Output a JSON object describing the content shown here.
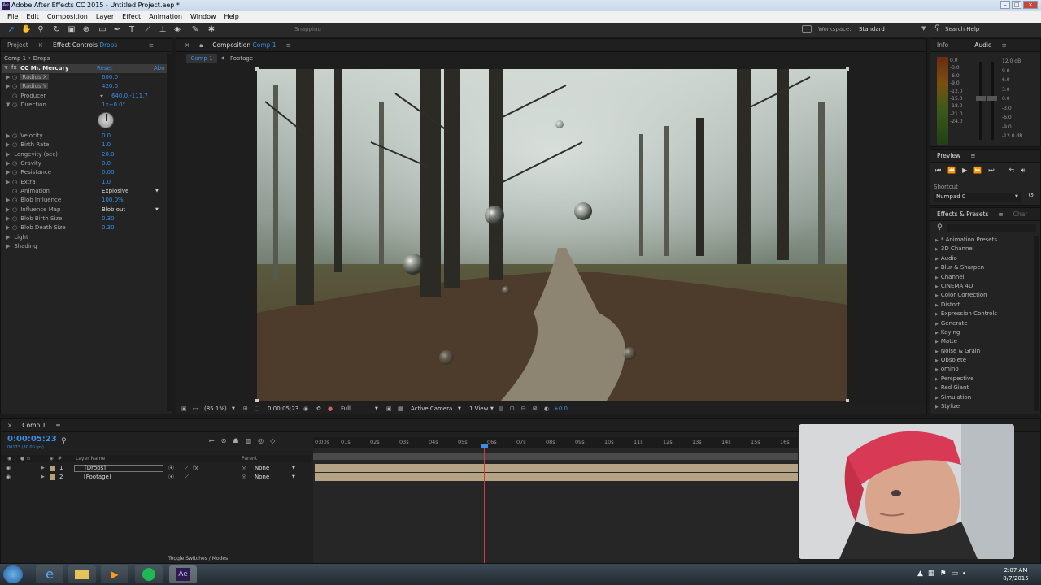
{
  "window": {
    "title": "Adobe After Effects CC 2015 - Untitled Project.aep *"
  },
  "menu": [
    "File",
    "Edit",
    "Composition",
    "Layer",
    "Effect",
    "Animation",
    "Window",
    "Help"
  ],
  "toolbar": {
    "snapping": "Snapping",
    "workspace_label": "Workspace:",
    "workspace_value": "Standard",
    "search_placeholder": "Search Help"
  },
  "effect_controls": {
    "tab_project": "Project",
    "tab_label": "Effect Controls",
    "tab_layer": "Drops",
    "breadcrumb": "Comp 1 • Drops",
    "effect_name": "CC Mr. Mercury",
    "reset": "Reset",
    "about": "Abo",
    "props": [
      {
        "label": "Radius X",
        "value": "600.0",
        "highlight": true
      },
      {
        "label": "Radius Y",
        "value": "420.0",
        "highlight": true
      },
      {
        "label": "Producer",
        "value": "640.0,-111.7"
      },
      {
        "label": "Direction",
        "value": "1x+0.0°"
      },
      {
        "label": "Velocity",
        "value": "0.0"
      },
      {
        "label": "Birth Rate",
        "value": "1.0"
      },
      {
        "label": "Longevity (sec)",
        "value": "20.0"
      },
      {
        "label": "Gravity",
        "value": "0.0"
      },
      {
        "label": "Resistance",
        "value": "0.00"
      },
      {
        "label": "Extra",
        "value": "1.0"
      },
      {
        "label": "Animation",
        "value": "Explosive"
      },
      {
        "label": "Blob Influence",
        "value": "100.0%"
      },
      {
        "label": "Influence Map",
        "value": "Blob out"
      },
      {
        "label": "Blob Birth Size",
        "value": "0.30"
      },
      {
        "label": "Blob Death Size",
        "value": "0.30"
      },
      {
        "label": "Light",
        "value": ""
      },
      {
        "label": "Shading",
        "value": ""
      }
    ]
  },
  "composition": {
    "tab_label": "Composition",
    "tab_comp": "Comp 1",
    "sub_tabs": [
      "Comp 1",
      "Footage"
    ],
    "zoom": "(85.1%)",
    "timecode": "0;00;05;23",
    "resolution": "Full",
    "camera": "Active Camera",
    "views": "1 View",
    "exposure": "+0.0"
  },
  "info_audio": {
    "tab_info": "Info",
    "tab_audio": "Audio",
    "left_scale": [
      "0.0",
      "-3.0",
      "-6.0",
      "-9.0",
      "-12.0",
      "-15.0",
      "-18.0",
      "-21.0",
      "-24.0"
    ],
    "right_scale": [
      "12.0 dB",
      "9.0",
      "6.0",
      "3.0",
      "0.0",
      "-3.0",
      "-6.0",
      "-9.0",
      "-12.0 dB"
    ]
  },
  "preview": {
    "tab_label": "Preview",
    "shortcut_label": "Shortcut",
    "shortcut_value": "Numpad 0"
  },
  "effects_presets": {
    "tab_label": "Effects & Presets",
    "tab_other": "Char",
    "items": [
      "* Animation Presets",
      "3D Channel",
      "Audio",
      "Blur & Sharpen",
      "Channel",
      "CINEMA 4D",
      "Color Correction",
      "Distort",
      "Expression Controls",
      "Generate",
      "Keying",
      "Matte",
      "Noise & Grain",
      "Obsolete",
      "omino",
      "Perspective",
      "Red Giant",
      "Simulation",
      "Stylize"
    ]
  },
  "timeline": {
    "tab_label": "Comp 1",
    "timecode": "0:00:05:23",
    "frame_info": "00173 (30.00 fps)",
    "col_layer_name": "Layer Name",
    "col_parent": "Parent",
    "ruler": [
      "0:00s",
      "01s",
      "02s",
      "03s",
      "04s",
      "05s",
      "06s",
      "07s",
      "08s",
      "09s",
      "10s",
      "11s",
      "12s",
      "13s",
      "14s",
      "15s",
      "16s"
    ],
    "layers": [
      {
        "num": "1",
        "name": "[Drops]",
        "parent": "None"
      },
      {
        "num": "2",
        "name": "[Footage]",
        "parent": "None"
      }
    ],
    "toggle_label": "Toggle Switches / Modes"
  },
  "taskbar": {
    "time": "2:07 AM",
    "date": "8/7/2015"
  }
}
